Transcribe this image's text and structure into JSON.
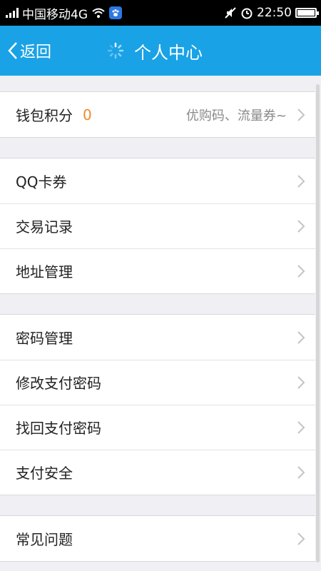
{
  "status_bar": {
    "carrier": "中国移动4G",
    "time": "22:50"
  },
  "nav": {
    "back_label": "返回",
    "title": "个人中心"
  },
  "groups": [
    [
      {
        "label": "钱包积分",
        "value": "0",
        "hint": "优购码、流量券~"
      }
    ],
    [
      {
        "label": "QQ卡券"
      },
      {
        "label": "交易记录"
      },
      {
        "label": "地址管理"
      }
    ],
    [
      {
        "label": "密码管理"
      },
      {
        "label": "修改支付密码"
      },
      {
        "label": "找回支付密码"
      },
      {
        "label": "支付安全"
      }
    ],
    [
      {
        "label": "常见问题"
      }
    ]
  ],
  "colors": {
    "nav_bg": "#1aa2e6",
    "value_accent": "#f08a2c",
    "page_bg": "#efeff4"
  },
  "icons": {
    "back": "chevron-left-icon",
    "loading": "spinner-icon",
    "row_arrow": "chevron-right-icon"
  }
}
